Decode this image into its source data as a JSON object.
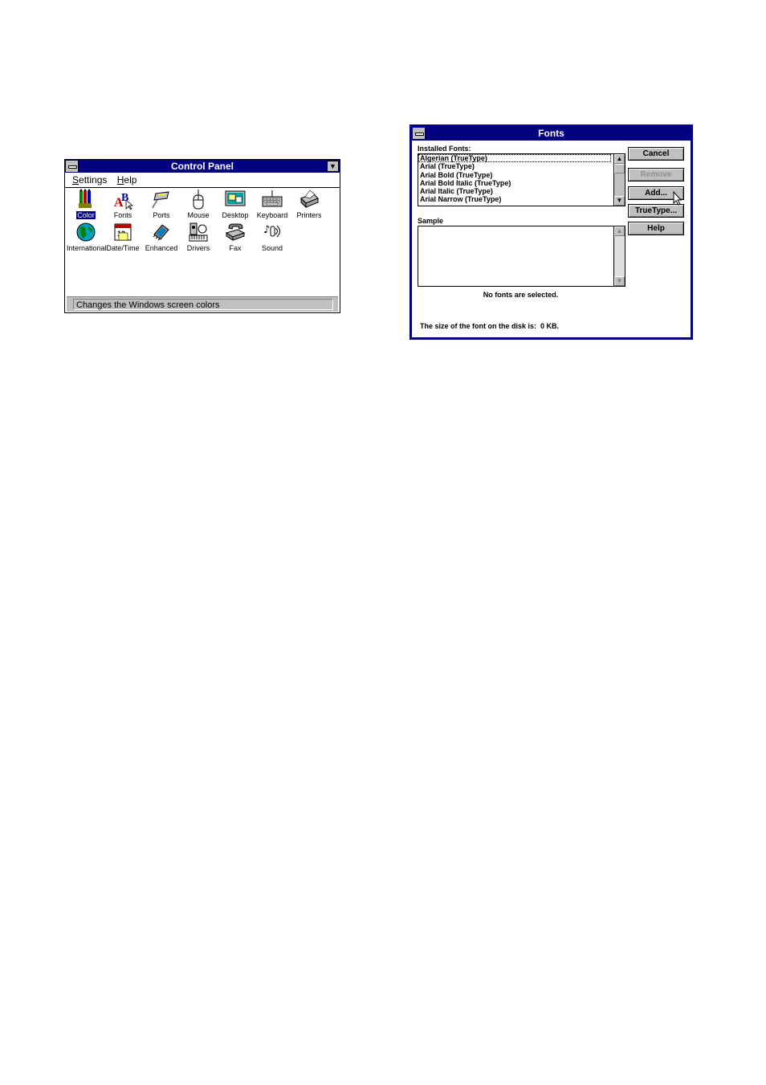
{
  "control_panel": {
    "title": "Control Panel",
    "menu": [
      {
        "label": "Settings",
        "underline": "S"
      },
      {
        "label": "Help",
        "underline": "H"
      }
    ],
    "icons": [
      {
        "label": "Color",
        "icon": "color-palette-icon"
      },
      {
        "label": "Fonts",
        "icon": "fonts-icon"
      },
      {
        "label": "Ports",
        "icon": "ports-icon"
      },
      {
        "label": "Mouse",
        "icon": "mouse-icon"
      },
      {
        "label": "Desktop",
        "icon": "desktop-icon"
      },
      {
        "label": "Keyboard",
        "icon": "keyboard-icon"
      },
      {
        "label": "Printers",
        "icon": "printer-icon"
      },
      {
        "label": "International",
        "icon": "globe-icon"
      },
      {
        "label": "Date/Time",
        "icon": "calendar-clock-icon"
      },
      {
        "label": "Enhanced",
        "icon": "chip-icon"
      },
      {
        "label": "Drivers",
        "icon": "drivers-icon"
      },
      {
        "label": "Fax",
        "icon": "fax-icon"
      },
      {
        "label": "Sound",
        "icon": "sound-icon"
      }
    ],
    "selected_icon": "Color",
    "status": "Changes the Windows screen colors"
  },
  "fonts_dialog": {
    "title": "Fonts",
    "installed_label": "Installed Fonts:",
    "installed_fonts": [
      "Algerian (TrueType)",
      "Arial (TrueType)",
      "Arial Bold (TrueType)",
      "Arial Bold Italic (TrueType)",
      "Arial Italic (TrueType)",
      "Arial Narrow (TrueType)"
    ],
    "sample_label": "Sample",
    "no_selection_text": "No fonts are selected.",
    "size_text": "The size of the font on the disk is:  0 KB.",
    "buttons": {
      "cancel": "Cancel",
      "remove": "Remove",
      "add": "Add...",
      "truetype": "TrueType...",
      "help": "Help"
    }
  },
  "colors": {
    "titlebar": "#000080",
    "face": "#c0c0c0"
  }
}
